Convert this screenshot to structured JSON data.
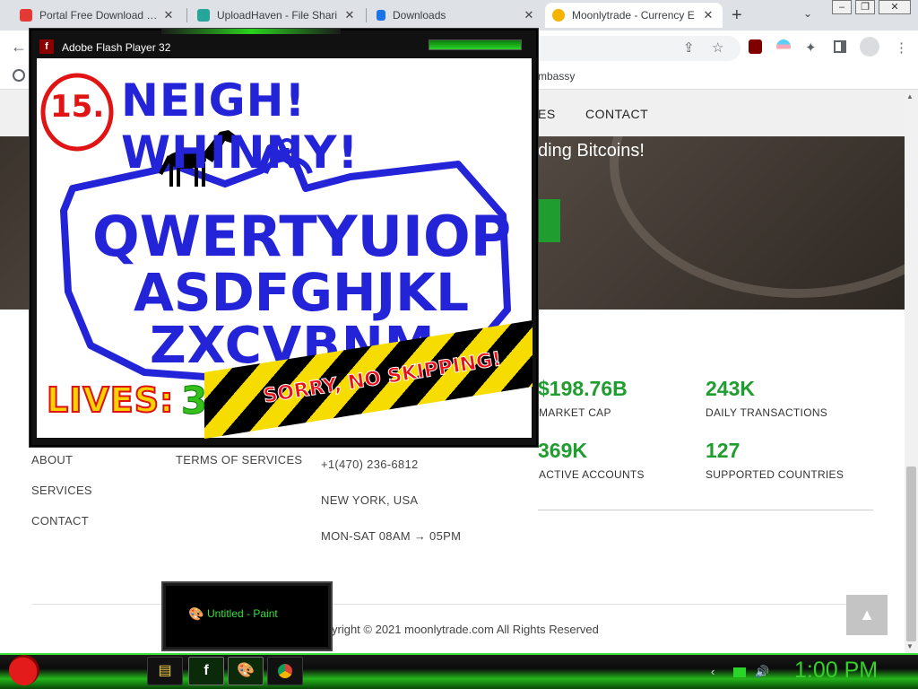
{
  "browser": {
    "tabs": [
      {
        "title": "Portal Free Download » S",
        "favicon_color": "#e53935"
      },
      {
        "title": "UploadHaven - File Shari",
        "favicon_color": "#26a69a"
      },
      {
        "title": "Downloads",
        "favicon_color": "#1a73e8"
      },
      {
        "title": "Moonlytrade - Currency E",
        "favicon_color": "#f4b400"
      }
    ],
    "new_tab": "+",
    "tab_search": "⌄",
    "close_glyph": "✕",
    "bookmark_text": "mbassy"
  },
  "site": {
    "nav": {
      "services_partial": "ES",
      "contact": "CONTACT"
    },
    "hero_text": "ding Bitcoins!",
    "stats": [
      {
        "value": "$198.76B",
        "label": "MARKET CAP"
      },
      {
        "value": "243K",
        "label": "DAILY TRANSACTIONS"
      },
      {
        "value": "369K",
        "label": "ACTIVE ACCOUNTS"
      },
      {
        "value": "127",
        "label": "SUPPORTED COUNTRIES"
      }
    ],
    "footer": {
      "links_col1": [
        "ABOUT",
        "SERVICES",
        "CONTACT"
      ],
      "links_col2": [
        "TERMS OF SERVICES"
      ],
      "contact": [
        "+1(470) 236-6812",
        "NEW YORK, USA",
        "MON-SAT 08AM → 05PM"
      ],
      "copyright": "yright © 2021 moonlytrade.com All Rights Reserved"
    },
    "to_top_glyph": "▲"
  },
  "flash": {
    "window_title": "Adobe Flash Player 32",
    "level": "15.",
    "headline": "NEIGH! WHINNY!",
    "keyboard_rows": [
      "QWERTYUIOP",
      "ASDFGHJKL",
      "ZXCVBNM"
    ],
    "lives_label": "LIVES:",
    "lives_value": "3",
    "banner_text": "SORRY, NO SKIPPING!",
    "colors": {
      "ink_blue": "#2323d8",
      "circle_red": "#e01414",
      "banner_yellow": "#f7dc00",
      "lives_green": "#35c01a"
    }
  },
  "taskbar": {
    "popup_label": "Untitled - Paint",
    "clock": "1:00 PM",
    "buttons": [
      "folder-icon",
      "flash-icon",
      "paint-icon",
      "chrome-icon"
    ],
    "accent": "#35d02a"
  }
}
